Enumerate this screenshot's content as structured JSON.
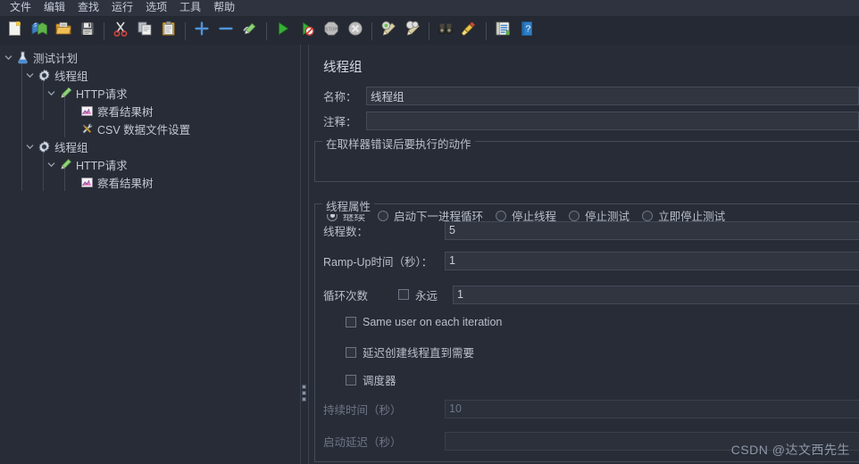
{
  "window": {
    "title": "JMeter",
    "accent": "#3f8fd0",
    "bg": "#282c36",
    "panel_bg": "#2f3340"
  },
  "menubar": {
    "items": [
      {
        "name": "menu-file",
        "label": "文件"
      },
      {
        "name": "menu-edit",
        "label": "编辑"
      },
      {
        "name": "menu-search",
        "label": "查找"
      },
      {
        "name": "menu-run",
        "label": "运行"
      },
      {
        "name": "menu-options",
        "label": "选项"
      },
      {
        "name": "menu-tools",
        "label": "工具"
      },
      {
        "name": "menu-help",
        "label": "帮助"
      }
    ]
  },
  "toolbar": {
    "buttons": [
      {
        "name": "new-icon",
        "title": "新建"
      },
      {
        "name": "templates-icon",
        "title": "模板"
      },
      {
        "name": "open-icon",
        "title": "打开"
      },
      {
        "name": "save-icon",
        "title": "保存"
      },
      {
        "name": "cut-icon",
        "title": "剪切"
      },
      {
        "name": "copy-icon",
        "title": "复制"
      },
      {
        "name": "paste-icon",
        "title": "粘贴"
      },
      {
        "name": "expand-all-icon",
        "title": "展开全部"
      },
      {
        "name": "collapse-all-icon",
        "title": "收起全部"
      },
      {
        "name": "toggle-icon",
        "title": "切换"
      },
      {
        "name": "start-icon",
        "title": "启动"
      },
      {
        "name": "start-no-pause-icon",
        "title": "无暂停启动"
      },
      {
        "name": "stop-icon",
        "title": "停止"
      },
      {
        "name": "shutdown-icon",
        "title": "关闭"
      },
      {
        "name": "clear-icon",
        "title": "清除"
      },
      {
        "name": "clear-all-icon",
        "title": "清除全部"
      },
      {
        "name": "search-icon",
        "title": "查找"
      },
      {
        "name": "reset-search-icon",
        "title": "重置查找"
      },
      {
        "name": "function-helper-icon",
        "title": "函数助手对话框"
      },
      {
        "name": "help-icon",
        "title": "帮助"
      }
    ]
  },
  "tree": {
    "nodes": [
      {
        "name": "tree-node-test-plan",
        "label": "测试计划",
        "depth": 0,
        "icon": "flask-icon",
        "twisty": "down"
      },
      {
        "name": "tree-node-thread-group",
        "label": "线程组",
        "depth": 1,
        "icon": "gear-icon",
        "twisty": "down"
      },
      {
        "name": "tree-node-http-request",
        "label": "HTTP请求",
        "depth": 2,
        "icon": "pencil-icon",
        "twisty": "down"
      },
      {
        "name": "tree-node-view-results",
        "label": "察看结果树",
        "depth": 3,
        "icon": "chart-icon",
        "twisty": "none"
      },
      {
        "name": "tree-node-csv-config",
        "label": "CSV 数据文件设置",
        "depth": 3,
        "icon": "tools-icon",
        "twisty": "none"
      },
      {
        "name": "tree-node-thread-group-2",
        "label": "线程组",
        "depth": 1,
        "icon": "gear-icon",
        "twisty": "down"
      },
      {
        "name": "tree-node-http-request-2",
        "label": "HTTP请求",
        "depth": 2,
        "icon": "pencil-icon",
        "twisty": "down"
      },
      {
        "name": "tree-node-view-results-2",
        "label": "察看结果树",
        "depth": 3,
        "icon": "chart-icon",
        "twisty": "none"
      }
    ]
  },
  "panel": {
    "title": "线程组",
    "name_label": "名称：",
    "name_value": "线程组",
    "comment_label": "注释：",
    "comment_value": "",
    "error_action": {
      "legend": "在取样器错误后要执行的动作",
      "options": [
        {
          "name": "radio-continue",
          "label": "继续",
          "selected": true
        },
        {
          "name": "radio-start-next",
          "label": "启动下一进程循环",
          "selected": false
        },
        {
          "name": "radio-stop-thread",
          "label": "停止线程",
          "selected": false
        },
        {
          "name": "radio-stop-test",
          "label": "停止测试",
          "selected": false
        },
        {
          "name": "radio-stop-test-now",
          "label": "立即停止测试",
          "selected": false
        }
      ]
    },
    "thread_props": {
      "legend": "线程属性",
      "threads_label": "线程数：",
      "threads_value": "5",
      "rampup_label": "Ramp-Up时间（秒）：",
      "rampup_value": "1",
      "loops_label": "循环次数",
      "forever_label": "永远",
      "forever_checked": false,
      "loops_value": "1",
      "same_user_label": "Same user on each iteration",
      "same_user_checked": false,
      "delay_create_label": "延迟创建线程直到需要",
      "delay_create_checked": false,
      "scheduler_label": "调度器",
      "scheduler_checked": false,
      "duration_label": "持续时间（秒）",
      "duration_value": "10",
      "duration_disabled": true,
      "startup_delay_label": "启动延迟（秒）",
      "startup_delay_value": "",
      "startup_delay_disabled": true
    }
  },
  "watermark": {
    "text": "CSDN @达文西先生"
  }
}
